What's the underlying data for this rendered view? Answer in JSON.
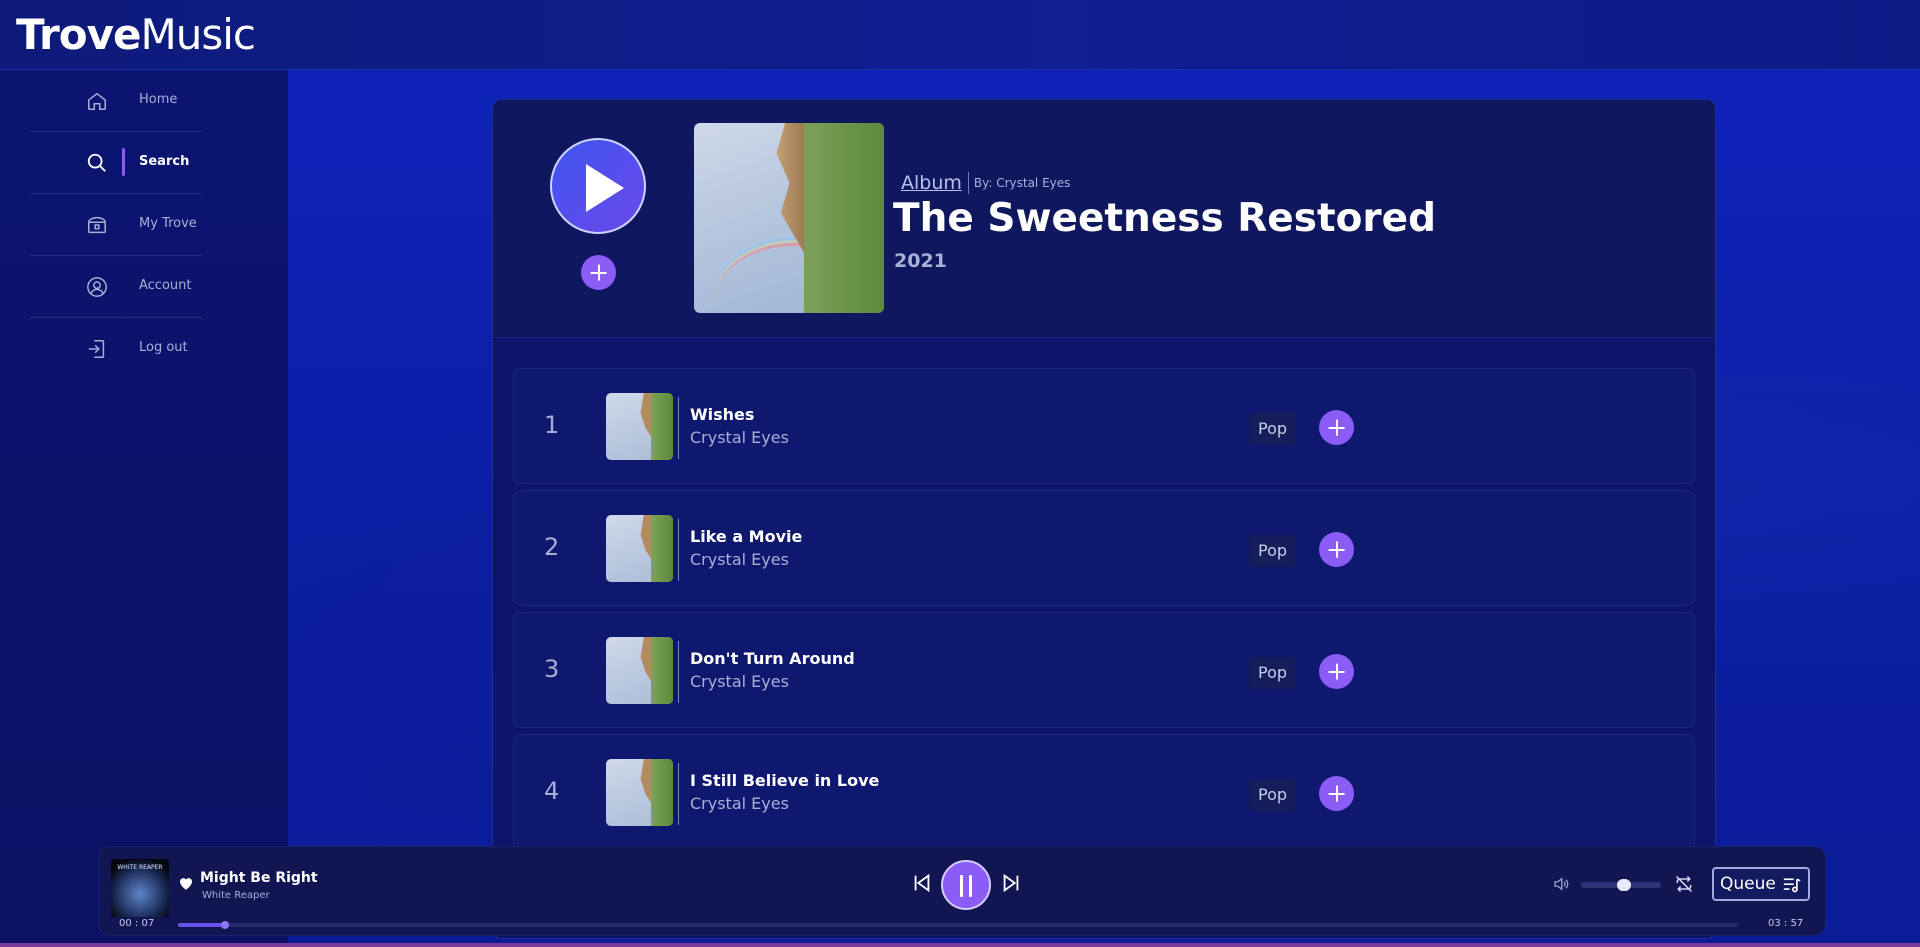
{
  "brand": {
    "bold": "Trove",
    "regular": "Music"
  },
  "sidebar": {
    "items": [
      {
        "label": "Home",
        "icon": "home-icon",
        "active": false
      },
      {
        "label": "Search",
        "icon": "search-icon",
        "active": true
      },
      {
        "label": "My Trove",
        "icon": "treasure-chest-icon",
        "active": false
      },
      {
        "label": "Account",
        "icon": "user-circle-icon",
        "active": false
      },
      {
        "label": "Log out",
        "icon": "logout-icon",
        "active": false
      }
    ]
  },
  "album": {
    "type": "Album",
    "by": "By: Crystal Eyes",
    "title": "The Sweetness Restored",
    "year": "2021"
  },
  "tracks": [
    {
      "number": "1",
      "title": "Wishes",
      "artist": "Crystal Eyes",
      "genre": "Pop"
    },
    {
      "number": "2",
      "title": "Like a Movie",
      "artist": "Crystal Eyes",
      "genre": "Pop"
    },
    {
      "number": "3",
      "title": "Don't Turn Around",
      "artist": "Crystal Eyes",
      "genre": "Pop"
    },
    {
      "number": "4",
      "title": "I Still Believe in Love",
      "artist": "Crystal Eyes",
      "genre": "Pop"
    }
  ],
  "player": {
    "title": "Might Be Right",
    "artist": "White Reaper",
    "art_text": "WHITE REAPER",
    "elapsed": "00 : 07",
    "duration": "03 : 57",
    "progress": 0.03,
    "volume": 0.45,
    "queue_label": "Queue"
  },
  "colors": {
    "accent": "#8b5cf6",
    "background": "#0c1fa8",
    "sidebar": "#0b1470",
    "card": "#0c1569"
  }
}
